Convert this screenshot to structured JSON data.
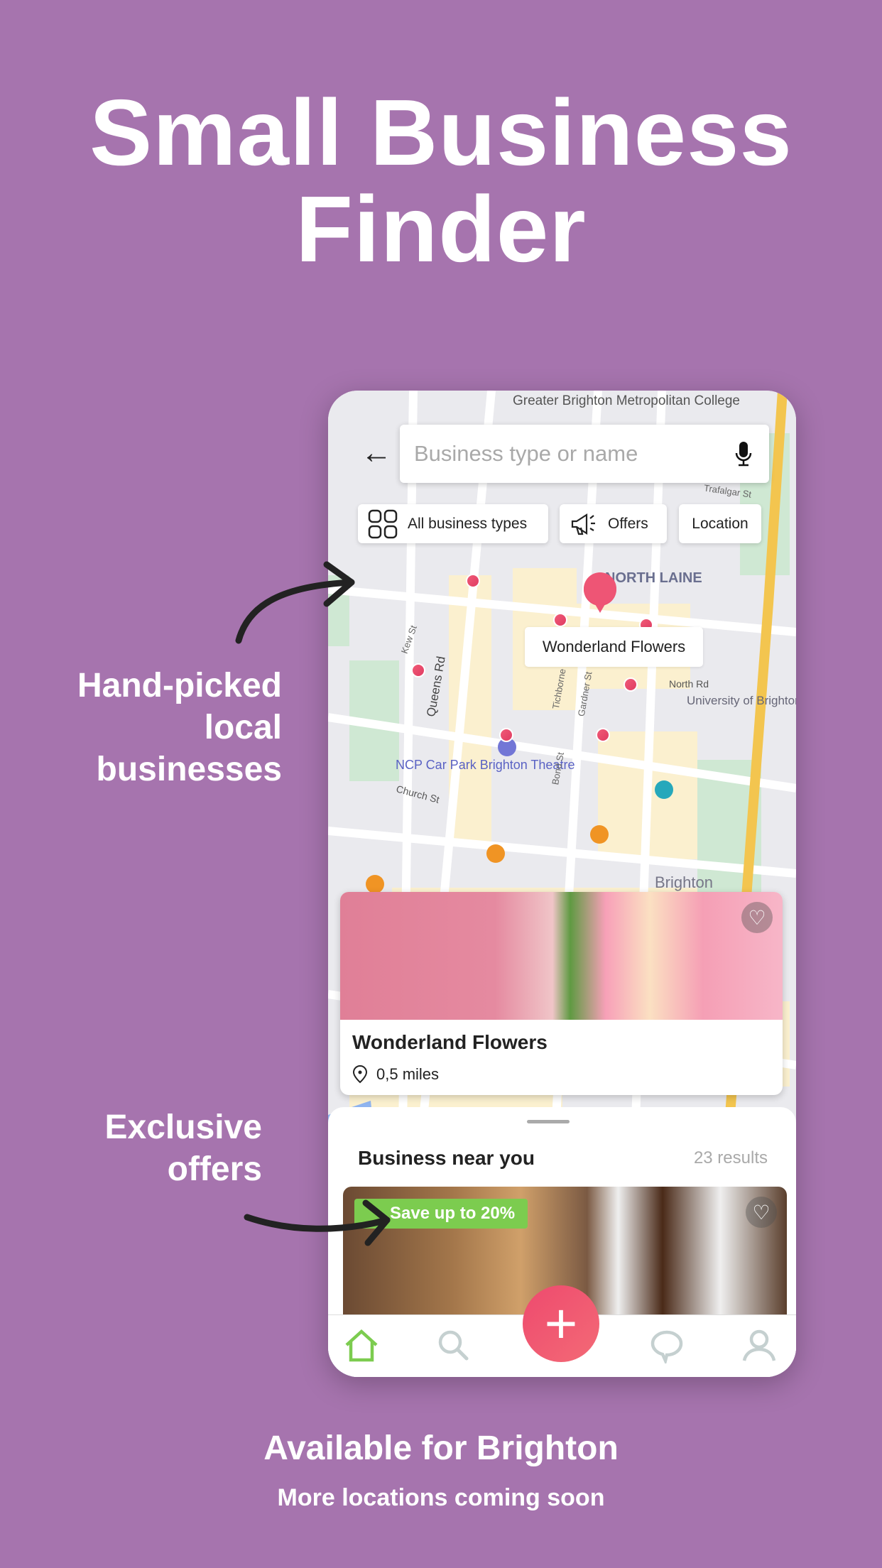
{
  "headline": {
    "line1": "Small Business",
    "line2": "Finder"
  },
  "callouts": {
    "local": [
      "Hand-picked",
      "local",
      "businesses"
    ],
    "offers": [
      "Exclusive",
      "offers"
    ]
  },
  "footer": {
    "line1": "Available for Brighton",
    "line2": "More locations coming soon"
  },
  "colors": {
    "background": "#a674ae",
    "accent": "#ee4a6e",
    "offer_green": "#7ccc4f",
    "nav_active": "#7ccc4f"
  },
  "app": {
    "search": {
      "placeholder": "Business type or name",
      "back_icon": "arrow-left-icon",
      "mic_icon": "microphone-icon"
    },
    "chips": [
      {
        "label": "All business types",
        "icon": "grid-icon"
      },
      {
        "label": "Offers",
        "icon": "megaphone-icon"
      },
      {
        "label": "Location"
      }
    ],
    "map": {
      "labels": [
        "Greater Brighton Metropolitan College",
        "NORTH LAINE",
        "Queens Rd",
        "Church St",
        "North Rd",
        "NCP Car Park Brighton Theatre",
        "University of Brighton City Campus",
        "Brighton",
        "Trafalgar St",
        "Tichborne St",
        "Gardner St",
        "Bond St",
        "Kew St"
      ],
      "selected_pin_label": "Wonderland Flowers"
    },
    "featured_card": {
      "name": "Wonderland Flowers",
      "distance": "0,5 miles"
    },
    "sheet": {
      "title": "Business near you",
      "count": "23 results",
      "offer_badge": "Save up to 20%"
    },
    "nav": [
      "home-icon",
      "search-icon",
      "add-icon",
      "chat-icon",
      "profile-icon"
    ]
  }
}
